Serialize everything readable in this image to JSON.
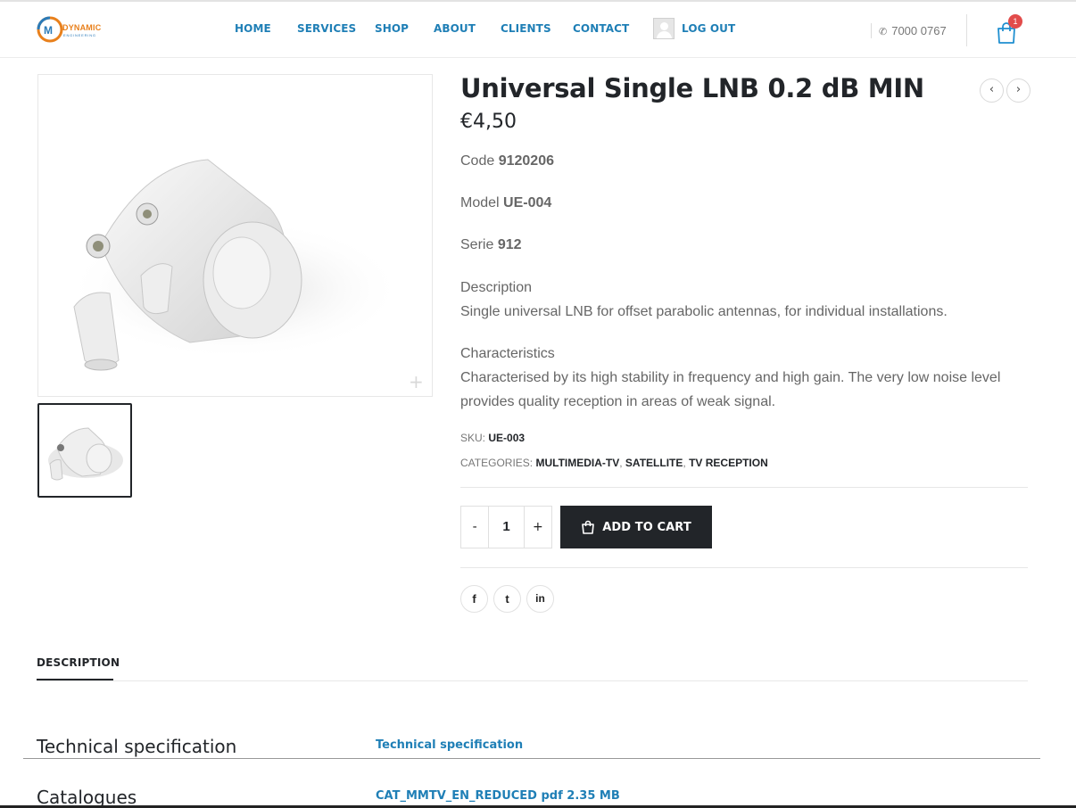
{
  "header": {
    "logo_text": "DYNAMIC",
    "logo_sub": "ENGINEERING",
    "nav": [
      "HOME",
      "SERVICES",
      "SHOP",
      "ABOUT",
      "CLIENTS",
      "CONTACT"
    ],
    "logout_label": "LOG OUT",
    "phone": "7000 0767",
    "cart_count": "1",
    "accent_color": "#1f7fb6"
  },
  "gallery": {
    "zoom_icon": "+"
  },
  "product": {
    "title": "Universal Single LNB 0.2 dB MIN",
    "price": "€4,50",
    "prev_icon": "‹",
    "next_icon": "›",
    "code_label": "Code",
    "code_value": "9120206",
    "model_label": "Model",
    "model_value": "UE-004",
    "serie_label": "Serie",
    "serie_value": "912",
    "description_heading": "Description",
    "description_text": "Single universal LNB for offset parabolic antennas, for individual installations.",
    "characteristics_heading": "Characteristics",
    "characteristics_text": "Characterised by its high stability in frequency and high gain. The very low noise level provides quality reception in areas of weak signal.",
    "sku_label": "SKU:",
    "sku_value": "UE-003",
    "categories_label": "CATEGORIES:",
    "categories": [
      "MULTIMEDIA-TV",
      "SATELLITE",
      "TV RECEPTION"
    ],
    "category_separator": ","
  },
  "cart_form": {
    "minus": "-",
    "quantity": "1",
    "plus": "+",
    "add_to_cart_label": "ADD TO CART"
  },
  "share": {
    "facebook": "f",
    "twitter": "t",
    "linkedin": "in"
  },
  "tabs": {
    "description_tab": "DESCRIPTION"
  },
  "specs": {
    "rows": [
      {
        "label": "Technical specification",
        "link": "Technical specification"
      },
      {
        "label": "Catalogues",
        "link": "CAT_MMTV_EN_REDUCED pdf 2.35 MB"
      }
    ]
  }
}
